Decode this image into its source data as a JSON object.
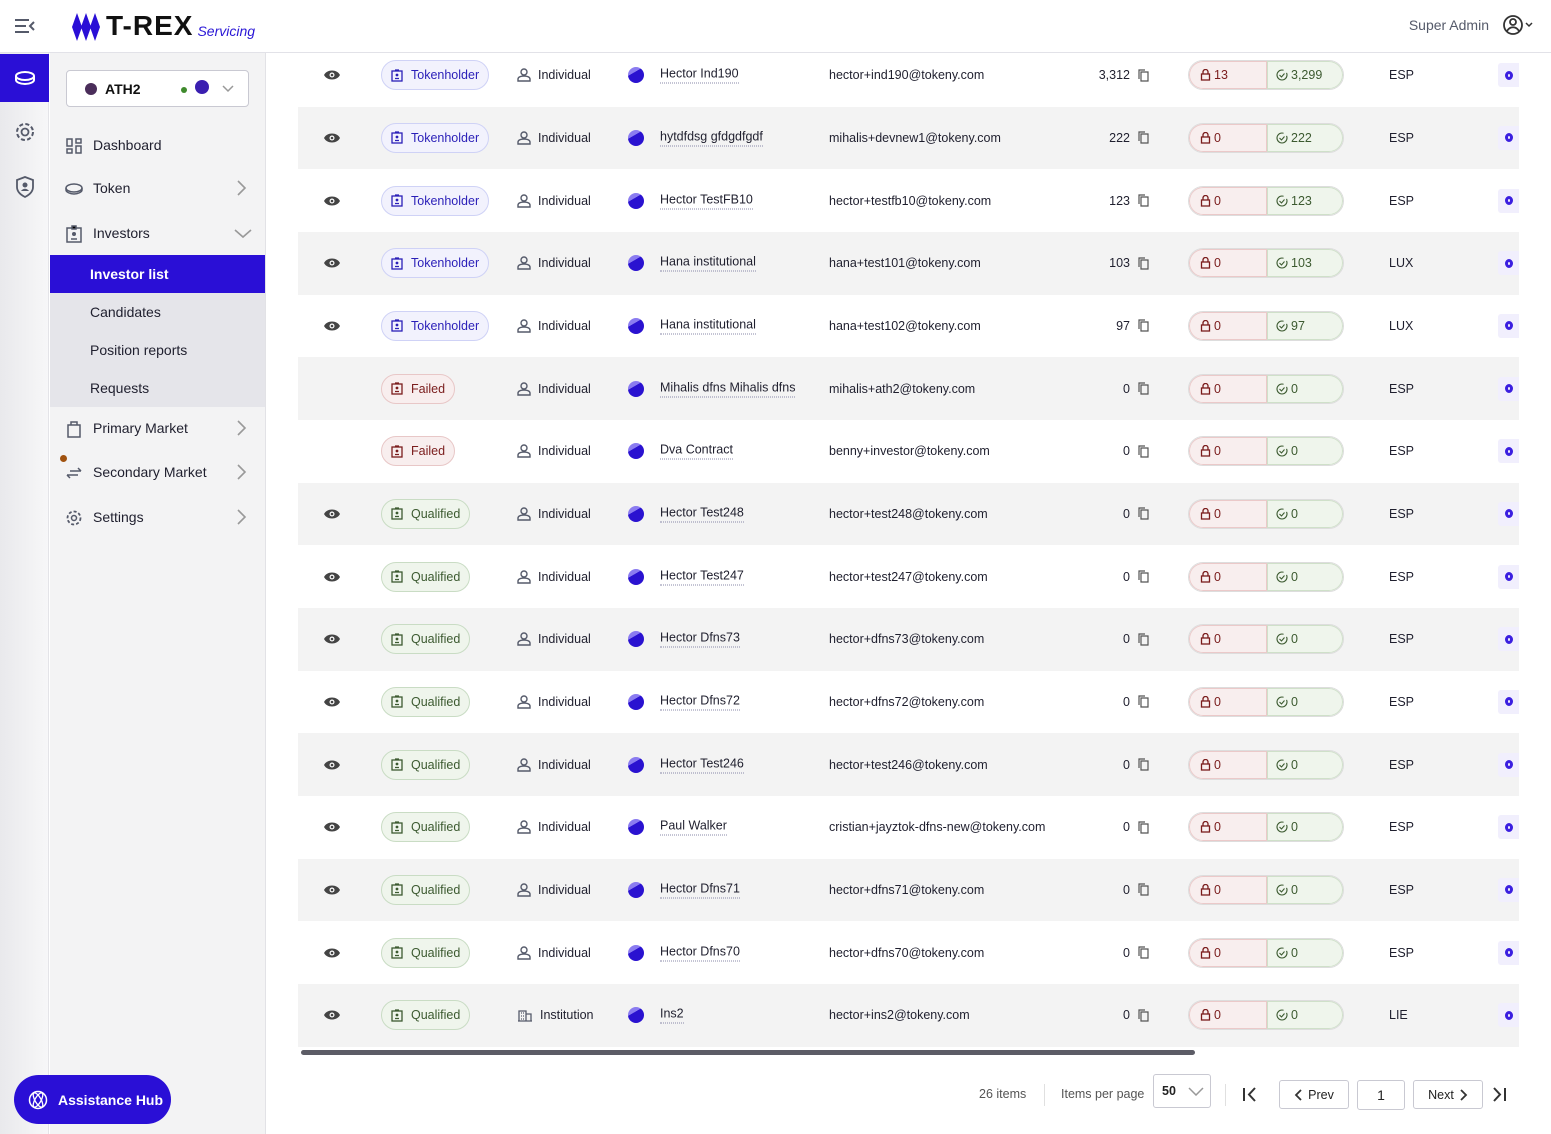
{
  "header": {
    "logo": "T-REX",
    "logo_sub": "Servicing",
    "user": "Super Admin"
  },
  "token_selector": {
    "value": "ATH2"
  },
  "nav": {
    "dashboard": "Dashboard",
    "token": "Token",
    "investors": "Investors",
    "investor_list": "Investor list",
    "candidates": "Candidates",
    "position_reports": "Position reports",
    "requests": "Requests",
    "primary_market": "Primary Market",
    "secondary_market": "Secondary Market",
    "settings": "Settings"
  },
  "assistance": "Assistance Hub",
  "colors": {
    "brand": "#2a0fd6",
    "failed": "#7a1c1c",
    "qualified": "#3c5a30"
  },
  "rows": [
    {
      "eye": true,
      "status": "Tokenholder",
      "kind": "tok",
      "type": "Individual",
      "name": "Hector Ind190",
      "email": "hector+ind190@tokeny.com",
      "balance": "3,312",
      "locked": "13",
      "free": "3,299",
      "country": "ESP"
    },
    {
      "eye": true,
      "status": "Tokenholder",
      "kind": "tok",
      "type": "Individual",
      "name": "hytdfdsg gfdgdfgdf",
      "email": "mihalis+devnew1@tokeny.com",
      "balance": "222",
      "locked": "0",
      "free": "222",
      "country": "ESP"
    },
    {
      "eye": true,
      "status": "Tokenholder",
      "kind": "tok",
      "type": "Individual",
      "name": "Hector TestFB10",
      "email": "hector+testfb10@tokeny.com",
      "balance": "123",
      "locked": "0",
      "free": "123",
      "country": "ESP"
    },
    {
      "eye": true,
      "status": "Tokenholder",
      "kind": "tok",
      "type": "Individual",
      "name": "Hana institutional",
      "email": "hana+test101@tokeny.com",
      "balance": "103",
      "locked": "0",
      "free": "103",
      "country": "LUX"
    },
    {
      "eye": true,
      "status": "Tokenholder",
      "kind": "tok",
      "type": "Individual",
      "name": "Hana institutional",
      "email": "hana+test102@tokeny.com",
      "balance": "97",
      "locked": "0",
      "free": "97",
      "country": "LUX"
    },
    {
      "eye": false,
      "status": "Failed",
      "kind": "fail",
      "type": "Individual",
      "name": "Mihalis dfns Mihalis dfns",
      "email": "mihalis+ath2@tokeny.com",
      "balance": "0",
      "locked": "0",
      "free": "0",
      "country": "ESP"
    },
    {
      "eye": false,
      "status": "Failed",
      "kind": "fail",
      "type": "Individual",
      "name": "Dva Contract",
      "email": "benny+investor@tokeny.com",
      "balance": "0",
      "locked": "0",
      "free": "0",
      "country": "ESP"
    },
    {
      "eye": true,
      "status": "Qualified",
      "kind": "qual",
      "type": "Individual",
      "name": "Hector Test248",
      "email": "hector+test248@tokeny.com",
      "balance": "0",
      "locked": "0",
      "free": "0",
      "country": "ESP"
    },
    {
      "eye": true,
      "status": "Qualified",
      "kind": "qual",
      "type": "Individual",
      "name": "Hector Test247",
      "email": "hector+test247@tokeny.com",
      "balance": "0",
      "locked": "0",
      "free": "0",
      "country": "ESP"
    },
    {
      "eye": true,
      "status": "Qualified",
      "kind": "qual",
      "type": "Individual",
      "name": "Hector Dfns73",
      "email": "hector+dfns73@tokeny.com",
      "balance": "0",
      "locked": "0",
      "free": "0",
      "country": "ESP"
    },
    {
      "eye": true,
      "status": "Qualified",
      "kind": "qual",
      "type": "Individual",
      "name": "Hector Dfns72",
      "email": "hector+dfns72@tokeny.com",
      "balance": "0",
      "locked": "0",
      "free": "0",
      "country": "ESP"
    },
    {
      "eye": true,
      "status": "Qualified",
      "kind": "qual",
      "type": "Individual",
      "name": "Hector Test246",
      "email": "hector+test246@tokeny.com",
      "balance": "0",
      "locked": "0",
      "free": "0",
      "country": "ESP"
    },
    {
      "eye": true,
      "status": "Qualified",
      "kind": "qual",
      "type": "Individual",
      "name": "Paul Walker",
      "email": "cristian+jayztok-dfns-new@tokeny.com",
      "balance": "0",
      "locked": "0",
      "free": "0",
      "country": "ESP"
    },
    {
      "eye": true,
      "status": "Qualified",
      "kind": "qual",
      "type": "Individual",
      "name": "Hector Dfns71",
      "email": "hector+dfns71@tokeny.com",
      "balance": "0",
      "locked": "0",
      "free": "0",
      "country": "ESP"
    },
    {
      "eye": true,
      "status": "Qualified",
      "kind": "qual",
      "type": "Individual",
      "name": "Hector Dfns70",
      "email": "hector+dfns70@tokeny.com",
      "balance": "0",
      "locked": "0",
      "free": "0",
      "country": "ESP"
    },
    {
      "eye": true,
      "status": "Qualified",
      "kind": "qual",
      "type": "Institution",
      "name": "Ins2",
      "email": "hector+ins2@tokeny.com",
      "balance": "0",
      "locked": "0",
      "free": "0",
      "country": "LIE"
    }
  ],
  "pagination": {
    "total": "26 items",
    "per_page_label": "Items per page",
    "per_page": "50",
    "prev": "Prev",
    "next": "Next",
    "page": "1"
  }
}
